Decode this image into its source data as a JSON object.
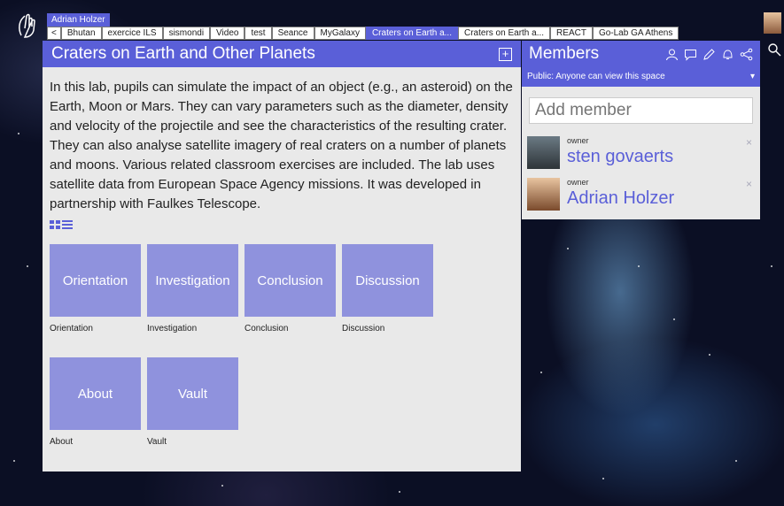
{
  "topbar": {
    "user_tag": "Adrian Holzer",
    "back_glyph": "<",
    "tabs": [
      "Bhutan",
      "exercice ILS",
      "sismondi",
      "Video",
      "test",
      "Seance",
      "MyGalaxy",
      "Craters on Earth a...",
      "Craters on Earth a...",
      "REACT",
      "Go-Lab GA Athens"
    ],
    "active_tab_index": 7
  },
  "main": {
    "title": "Craters on Earth and Other Planets",
    "expand_glyph": "+",
    "description": "In this lab, pupils can simulate the impact of an object (e.g., an asteroid) on the Earth, Moon or Mars. They can vary parameters such as the diameter, density and velocity of the projectile and see the characteristics of the resulting crater. They can also analyse satellite imagery of real craters on a number of planets and moons. Various related classroom exercises are included. The lab uses satellite data from European Space Agency missions. It was developed in partnership with Faulkes Telescope.",
    "phases": [
      {
        "tile": "Orientation",
        "label": "Orientation"
      },
      {
        "tile": "Investigation",
        "label": "Investigation"
      },
      {
        "tile": "Conclusion",
        "label": "Conclusion"
      },
      {
        "tile": "Discussion",
        "label": "Discussion"
      },
      {
        "tile": "About",
        "label": "About"
      },
      {
        "tile": "Vault",
        "label": "Vault"
      }
    ]
  },
  "members": {
    "title": "Members",
    "visibility": "Public: Anyone can view this space",
    "add_placeholder": "Add member",
    "list": [
      {
        "role": "owner",
        "name": "sten govaerts",
        "remove": "×"
      },
      {
        "role": "owner",
        "name": "Adrian Holzer",
        "remove": "×"
      }
    ]
  },
  "colors": {
    "accent": "#5a5fd8",
    "tile": "#8f92dd",
    "panel": "#e9e9e9"
  },
  "icons": [
    "hand-logo-icon",
    "person-icon",
    "chat-icon",
    "pencil-icon",
    "bell-icon",
    "share-icon",
    "search-icon",
    "grid-view-icon",
    "list-view-icon",
    "chevron-down-icon"
  ]
}
